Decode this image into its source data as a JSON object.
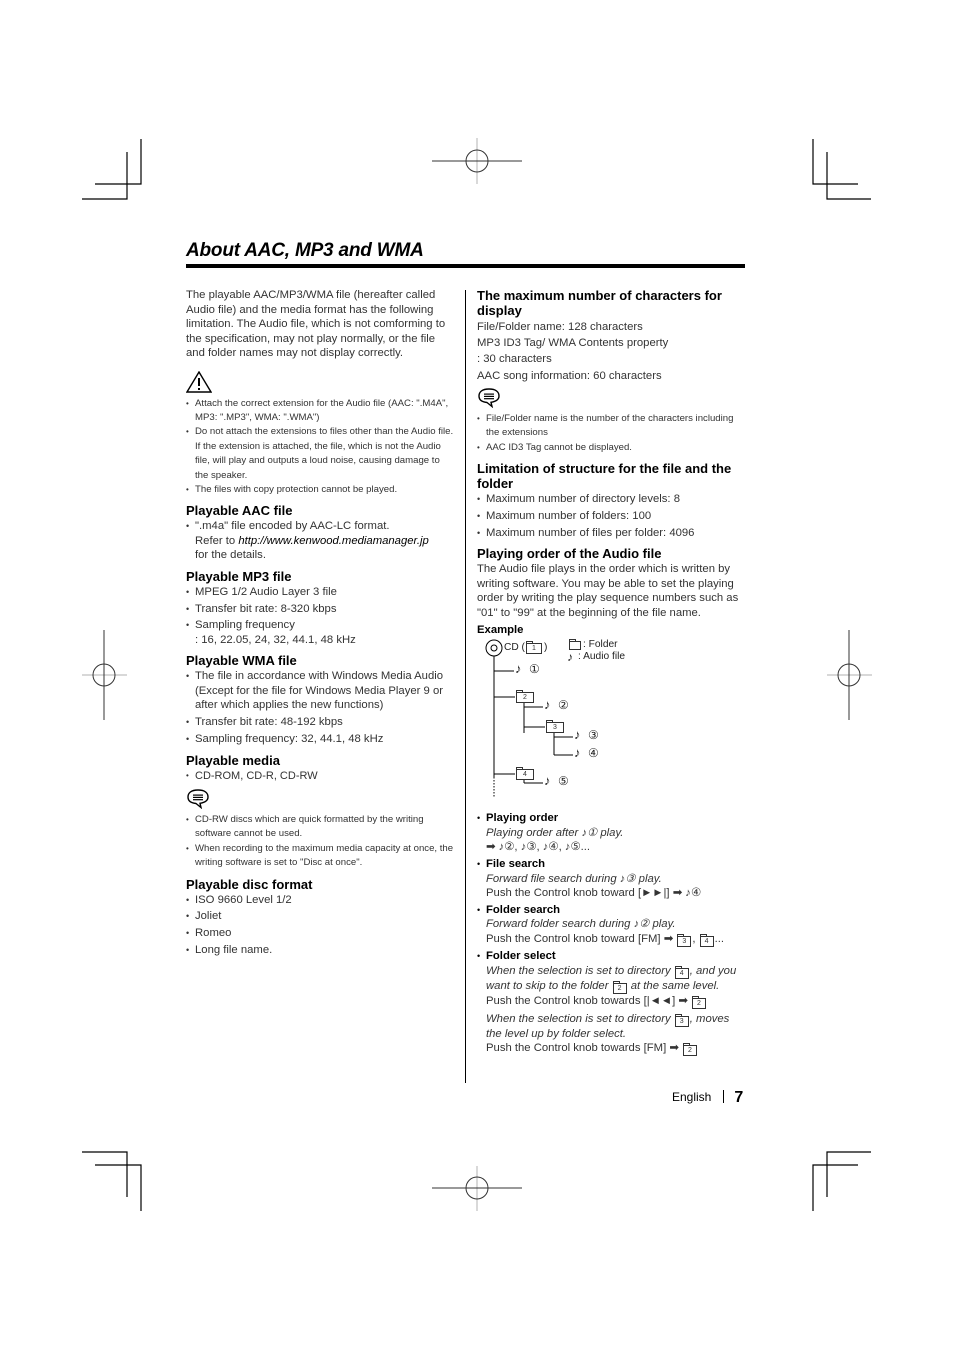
{
  "page": {
    "title": "About AAC, MP3 and WMA",
    "footer": {
      "language": "English",
      "page_number": "7"
    }
  },
  "left_column": {
    "intro": "The playable AAC/MP3/WMA file (hereafter called Audio file) and the media format has the following limitation. The Audio file, which is not comforming to the specification, may not play normally, or the file and folder names may not display correctly.",
    "caution_icon": "warning-triangle-icon",
    "caution_items": [
      "Attach the correct extension for the Audio file (AAC: \".M4A\", MP3: \".MP3\", WMA: \".WMA\")",
      "Do not attach the extensions to files other than the Audio file. If the extension is attached, the file, which is not the Audio file, will play and outputs a loud noise, causing damage to the speaker.",
      "The files with copy protection cannot be played."
    ],
    "aac": {
      "heading": "Playable AAC file",
      "item_line1": "\".m4a\" file encoded by AAC-LC format.",
      "item_refer_prefix": "Refer to ",
      "item_link": "http://www.kenwood.mediamanager.jp",
      "item_suffix": "for the details."
    },
    "mp3": {
      "heading": "Playable MP3 file",
      "items": [
        "MPEG 1/2 Audio Layer 3 file",
        "Transfer bit rate: 8-320 kbps"
      ],
      "sampling_label": "Sampling frequency",
      "sampling_values": ": 16, 22.05, 24, 32, 44.1, 48 kHz"
    },
    "wma": {
      "heading": "Playable WMA file",
      "items": [
        "The file in accordance with Windows Media Audio (Except for the file for Windows Media Player 9 or after which applies the new functions)",
        "Transfer bit rate: 48-192 kbps",
        "Sampling frequency: 32, 44.1, 48 kHz"
      ]
    },
    "media": {
      "heading": "Playable media",
      "items": [
        "CD-ROM, CD-R, CD-RW"
      ],
      "note_icon": "note-speech-bubble-icon",
      "notes": [
        "CD-RW discs which are quick formatted by the writing software cannot be used.",
        "When recording to the maximum media capacity at once, the writing software is set to \"Disc at once\"."
      ]
    },
    "disc_format": {
      "heading": "Playable disc format",
      "items": [
        "ISO 9660 Level 1/2",
        "Joliet",
        "Romeo",
        "Long file name."
      ]
    }
  },
  "right_column": {
    "max_chars": {
      "heading": "The maximum number of characters for display",
      "lines": [
        "File/Folder name: 128 characters",
        "MP3 ID3 Tag/ WMA Contents property",
        ": 30 characters",
        "AAC song information: 60 characters"
      ],
      "note_icon": "note-speech-bubble-icon",
      "notes": [
        "File/Folder name is the number of the characters including the extensions",
        "AAC ID3 Tag cannot be displayed."
      ]
    },
    "structure": {
      "heading": "Limitation of structure for the file and the folder",
      "items": [
        "Maximum number of directory levels: 8",
        "Maximum number of folders: 100",
        "Maximum number of files per folder: 4096"
      ]
    },
    "playing_order": {
      "heading": "Playing order of the Audio file",
      "text": "The Audio file plays in the order which is written by writing software. You may be able to set the playing order by writing the play sequence numbers such as \"01\" to \"99\" at the beginning of the file name.",
      "example_label": "Example",
      "diagram": {
        "root_label": "CD (",
        "root_close": ")",
        "legend_folder": ": Folder",
        "legend_audio": ": Audio file",
        "folders": [
          "1",
          "2",
          "3",
          "4"
        ],
        "files": [
          "①",
          "②",
          "③",
          "④",
          "⑤"
        ]
      }
    },
    "operations": [
      {
        "title": "Playing order",
        "line1_prefix": "Playing order after ",
        "line1_num": "①",
        "line1_suffix": " play.",
        "sequence": [
          "②",
          "③",
          "④",
          "⑤"
        ],
        "sequence_end": "..."
      },
      {
        "title": "File search",
        "line1_prefix": "Forward file search during ",
        "line1_num": "③",
        "line1_suffix": " play.",
        "line2_prefix": "Push the Control knob toward [",
        "line2_key": "►►|",
        "line2_suffix": "] ",
        "result_num": "④"
      },
      {
        "title": "Folder search",
        "line1_prefix": "Forward folder search during ",
        "line1_num": "②",
        "line1_suffix": " play.",
        "line2": "Push the Control knob toward [FM] ",
        "result_folders": [
          "3",
          "4"
        ],
        "result_end": "..."
      },
      {
        "title": "Folder select",
        "case1_a": "When the selection is set to directory ",
        "case1_folder_a": "4",
        "case1_b": ", and you want to skip to the folder ",
        "case1_folder_b": "2",
        "case1_c": " at the same level.",
        "case1_push_prefix": "Push the Control knob towards [",
        "case1_key": "|◄◄",
        "case1_push_suffix": "] ",
        "case1_result": "2",
        "case2_a": "When the selection is set to directory ",
        "case2_folder": "3",
        "case2_b": ", moves the level up by folder select.",
        "case2_push": "Push the Control knob towards [FM] ",
        "case2_result": "2"
      }
    ]
  }
}
